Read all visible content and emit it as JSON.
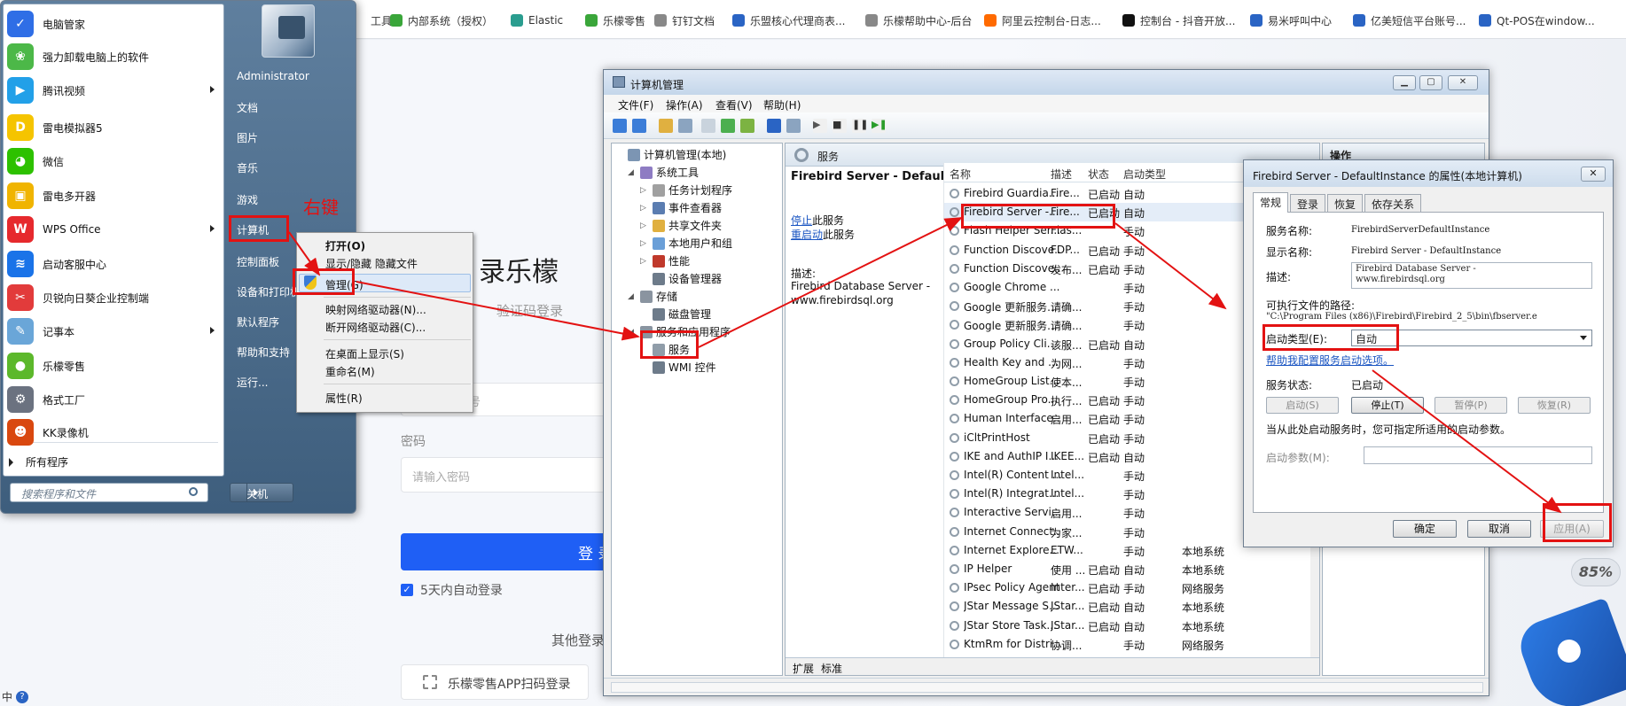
{
  "bookmarks": [
    {
      "label": "工具",
      "color": "#ffffff"
    },
    {
      "label": "内部系统（授权）",
      "color": "#3aa63a"
    },
    {
      "label": "Elastic",
      "color": "#2a9d8f"
    },
    {
      "label": "乐檬零售",
      "color": "#3aa63a"
    },
    {
      "label": "钉钉文档",
      "color": "#888888"
    },
    {
      "label": "乐盟核心代理商表...",
      "color": "#2a64c4"
    },
    {
      "label": "乐檬帮助中心-后台",
      "color": "#888888"
    },
    {
      "label": "阿里云控制台-日志...",
      "color": "#ff6a00"
    },
    {
      "label": "控制台 - 抖音开放...",
      "color": "#111111"
    },
    {
      "label": "易米呼叫中心",
      "color": "#2a64c4"
    },
    {
      "label": "亿美短信平台账号...",
      "color": "#2a64c4"
    },
    {
      "label": "Qt-POS在window...",
      "color": "#2a64c4"
    }
  ],
  "login": {
    "title": "录乐檬",
    "subtitle": "验证码登录",
    "account_hint": "号",
    "password_label": "密码",
    "password_placeholder": "请输入密码",
    "login_button": "登 录",
    "remember": "5天内自动登录",
    "other": "其他登录",
    "qr_button": "乐檬零售APP扫码登录"
  },
  "start_menu": {
    "programs": [
      {
        "label": "电脑管家",
        "icon": "shield-icon",
        "color": "#2f6ee6",
        "glyph": "✓",
        "arrow": false
      },
      {
        "label": "强力卸载电脑上的软件",
        "icon": "colorful-icon",
        "color": "#4cb848",
        "glyph": "❀",
        "arrow": false
      },
      {
        "label": "腾讯视频",
        "icon": "video-icon",
        "color": "#22a0e8",
        "glyph": "▶",
        "arrow": true
      },
      {
        "label": "雷电模拟器5",
        "icon": "thunder-icon",
        "color": "#f5c400",
        "glyph": "D",
        "arrow": false
      },
      {
        "label": "微信",
        "icon": "wechat-icon",
        "color": "#2dc100",
        "glyph": "◕",
        "arrow": false
      },
      {
        "label": "雷电多开器",
        "icon": "thunder-multi-icon",
        "color": "#f0b400",
        "glyph": "▣",
        "arrow": false
      },
      {
        "label": "WPS Office",
        "icon": "wps-icon",
        "color": "#e6292d",
        "glyph": "W",
        "arrow": true
      },
      {
        "label": "启动客服中心",
        "icon": "wifi-icon",
        "color": "#1a73e8",
        "glyph": "≋",
        "arrow": false
      },
      {
        "label": "贝锐向日葵企业控制端",
        "icon": "sunflower-icon",
        "color": "#e23b3b",
        "glyph": "✂",
        "arrow": false
      },
      {
        "label": "记事本",
        "icon": "notepad-icon",
        "color": "#6aa6d8",
        "glyph": "✎",
        "arrow": true
      },
      {
        "label": "乐檬零售",
        "icon": "apple-icon",
        "color": "#5cb82b",
        "glyph": "●",
        "arrow": false
      },
      {
        "label": "格式工厂",
        "icon": "factory-icon",
        "color": "#6b7280",
        "glyph": "⚙",
        "arrow": false
      },
      {
        "label": "KK录像机",
        "icon": "kk-icon",
        "color": "#d9480f",
        "glyph": "☻",
        "arrow": false
      }
    ],
    "all_programs": "所有程序",
    "search_placeholder": "搜索程序和文件",
    "right_items": [
      "Administrator",
      "文档",
      "图片",
      "音乐",
      "游戏",
      "计算机",
      "控制面板",
      "设备和打印机",
      "默认程序",
      "帮助和支持",
      "运行..."
    ],
    "shutdown": "关机"
  },
  "context_menu": {
    "items": [
      "打开(O)",
      "显示/隐藏 隐藏文件",
      "管理(G)",
      "映射网络驱动器(N)...",
      "断开网络驱动器(C)...",
      "在桌面上显示(S)",
      "重命名(M)",
      "属性(R)"
    ]
  },
  "annotation": {
    "right_click": "右键",
    "color": "#e31212"
  },
  "mmc": {
    "title": "计算机管理",
    "menus": [
      "文件(F)",
      "操作(A)",
      "查看(V)",
      "帮助(H)"
    ],
    "tree": [
      {
        "label": "计算机管理(本地)",
        "depth": 0,
        "exp": "",
        "color": "#7c95b3"
      },
      {
        "label": "系统工具",
        "depth": 1,
        "exp": "◢",
        "color": "#8e7cc3"
      },
      {
        "label": "任务计划程序",
        "depth": 2,
        "exp": "▷",
        "color": "#a0a0a0"
      },
      {
        "label": "事件查看器",
        "depth": 2,
        "exp": "▷",
        "color": "#5b7db1"
      },
      {
        "label": "共享文件夹",
        "depth": 2,
        "exp": "▷",
        "color": "#e0b040"
      },
      {
        "label": "本地用户和组",
        "depth": 2,
        "exp": "▷",
        "color": "#6a9fd8"
      },
      {
        "label": "性能",
        "depth": 2,
        "exp": "▷",
        "color": "#c0392b"
      },
      {
        "label": "设备管理器",
        "depth": 2,
        "exp": "",
        "color": "#6d7b8a"
      },
      {
        "label": "存储",
        "depth": 1,
        "exp": "◢",
        "color": "#8a94a0"
      },
      {
        "label": "磁盘管理",
        "depth": 2,
        "exp": "",
        "color": "#6d7b8a"
      },
      {
        "label": "服务和应用程序",
        "depth": 1,
        "exp": "◢",
        "color": "#8a94a0"
      },
      {
        "label": "服务",
        "depth": 2,
        "exp": "",
        "color": "#909da9"
      },
      {
        "label": "WMI 控件",
        "depth": 2,
        "exp": "",
        "color": "#6d7b8a"
      }
    ],
    "services_header": "服务",
    "selected_service": "Firebird Server - DefaultInstance",
    "stop_link": "停止",
    "stop_suffix": "此服务",
    "restart_link": "重启动",
    "restart_suffix": "此服务",
    "desc_label": "描述:",
    "desc_line1": "Firebird Database Server -",
    "desc_line2": "www.firebirdsql.org",
    "columns": [
      "名称",
      "描述",
      "状态",
      "启动类型"
    ],
    "services": [
      {
        "name": "Firebird Guardia...",
        "desc": "Fire...",
        "status": "已启动",
        "startup": "自动",
        "logon": ""
      },
      {
        "name": "Firebird Server -...",
        "desc": "Fire...",
        "status": "已启动",
        "startup": "自动",
        "logon": ""
      },
      {
        "name": "Flash Helper Ser...",
        "desc": "Flas...",
        "status": "",
        "startup": "手动",
        "logon": ""
      },
      {
        "name": "Function Discove...",
        "desc": "FDP...",
        "status": "已启动",
        "startup": "手动",
        "logon": ""
      },
      {
        "name": "Function Discove...",
        "desc": "发布...",
        "status": "已启动",
        "startup": "手动",
        "logon": ""
      },
      {
        "name": "Google Chrome ...",
        "desc": "",
        "status": "",
        "startup": "手动",
        "logon": ""
      },
      {
        "name": "Google 更新服务...",
        "desc": "请确...",
        "status": "",
        "startup": "手动",
        "logon": ""
      },
      {
        "name": "Google 更新服务...",
        "desc": "请确...",
        "status": "",
        "startup": "手动",
        "logon": ""
      },
      {
        "name": "Group Policy Cli...",
        "desc": "该服...",
        "status": "已启动",
        "startup": "自动",
        "logon": ""
      },
      {
        "name": "Health Key and ...",
        "desc": "为网...",
        "status": "",
        "startup": "手动",
        "logon": ""
      },
      {
        "name": "HomeGroup List...",
        "desc": "使本...",
        "status": "",
        "startup": "手动",
        "logon": ""
      },
      {
        "name": "HomeGroup Pro...",
        "desc": "执行...",
        "status": "已启动",
        "startup": "手动",
        "logon": ""
      },
      {
        "name": "Human Interface...",
        "desc": "启用...",
        "status": "已启动",
        "startup": "手动",
        "logon": ""
      },
      {
        "name": "iCltPrintHost",
        "desc": "",
        "status": "已启动",
        "startup": "手动",
        "logon": ""
      },
      {
        "name": "IKE and AuthIP I...",
        "desc": "IKEE...",
        "status": "已启动",
        "startup": "自动",
        "logon": ""
      },
      {
        "name": "Intel(R) Content ...",
        "desc": "Intel...",
        "status": "",
        "startup": "手动",
        "logon": ""
      },
      {
        "name": "Intel(R) Integrat...",
        "desc": "Intel...",
        "status": "",
        "startup": "手动",
        "logon": ""
      },
      {
        "name": "Interactive Servi...",
        "desc": "启用...",
        "status": "",
        "startup": "手动",
        "logon": ""
      },
      {
        "name": "Internet Connect...",
        "desc": "为家...",
        "status": "",
        "startup": "手动",
        "logon": ""
      },
      {
        "name": "Internet Explore...",
        "desc": "ETW...",
        "status": "",
        "startup": "手动",
        "logon": "本地系统"
      },
      {
        "name": "IP Helper",
        "desc": "使用 ...",
        "status": "已启动",
        "startup": "自动",
        "logon": "本地系统"
      },
      {
        "name": "IPsec Policy Agent",
        "desc": "Inter...",
        "status": "已启动",
        "startup": "手动",
        "logon": "网络服务"
      },
      {
        "name": "JStar Message S...",
        "desc": "JStar...",
        "status": "已启动",
        "startup": "自动",
        "logon": "本地系统"
      },
      {
        "name": "JStar Store Task...",
        "desc": "JStar...",
        "status": "已启动",
        "startup": "自动",
        "logon": "本地系统"
      },
      {
        "name": "KtmRm for Distri...",
        "desc": "协调...",
        "status": "",
        "startup": "手动",
        "logon": "网络服务"
      }
    ],
    "tabs": [
      "扩展",
      "标准"
    ],
    "actions_header": "操作"
  },
  "dialog": {
    "title": "Firebird Server - DefaultInstance 的属性(本地计算机)",
    "tabs": [
      "常规",
      "登录",
      "恢复",
      "依存关系"
    ],
    "service_name_label": "服务名称:",
    "service_name": "FirebirdServerDefaultInstance",
    "display_name_label": "显示名称:",
    "display_name": "Firebird Server - DefaultInstance",
    "desc_label": "描述:",
    "desc_line1": "Firebird Database Server -",
    "desc_line2": "www.firebirdsql.org",
    "path_label": "可执行文件的路径:",
    "path": "\"C:\\Program Files (x86)\\Firebird\\Firebird_2_5\\bin\\fbserver.e",
    "startup_label": "启动类型(E):",
    "startup_value": "自动",
    "help_link": "帮助我配置服务启动选项。",
    "status_label": "服务状态:",
    "status_value": "已启动",
    "buttons_state": [
      "启动(S)",
      "停止(T)",
      "暂停(P)",
      "恢复(R)"
    ],
    "hint": "当从此处启动服务时，您可指定所适用的启动参数。",
    "param_label": "启动参数(M):",
    "ok": "确定",
    "cancel": "取消",
    "apply": "应用(A)"
  },
  "badge": "85%",
  "tray": {
    "ime": "中"
  }
}
